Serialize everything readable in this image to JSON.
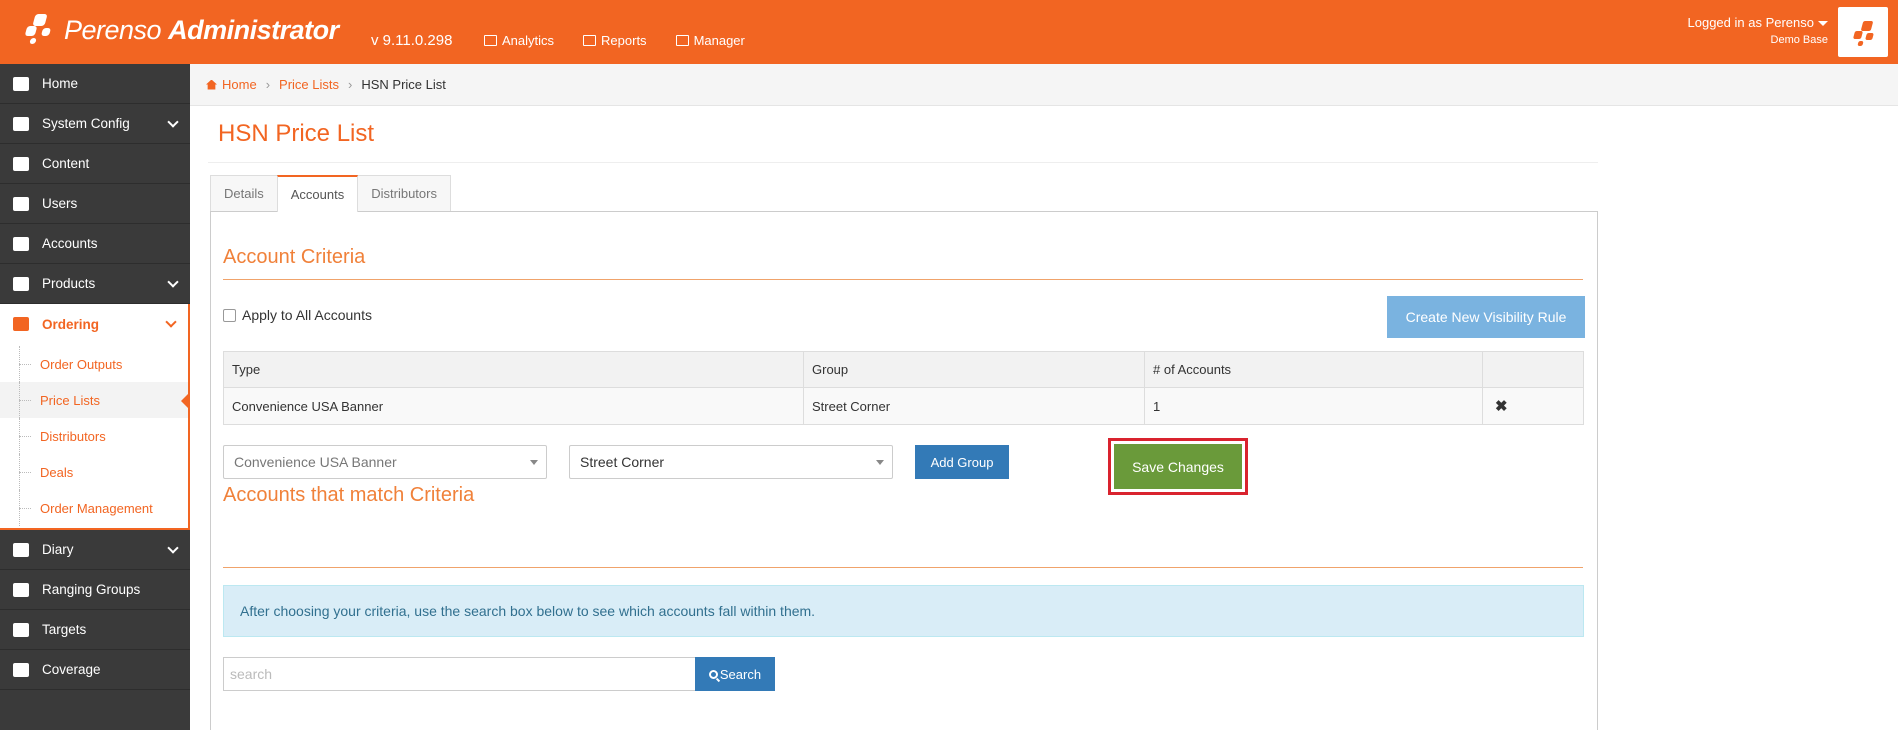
{
  "header": {
    "brand_light": "Perenso",
    "brand_bold": "Administrator",
    "version": "v 9.11.0.298",
    "nav": [
      {
        "label": "Analytics",
        "icon": "chart-icon"
      },
      {
        "label": "Reports",
        "icon": "table-icon"
      },
      {
        "label": "Manager",
        "icon": "briefcase-icon"
      }
    ],
    "user": "Logged in as Perenso",
    "base": "Demo Base",
    "accent_color": "#f26522"
  },
  "sidebar": {
    "items": [
      {
        "label": "Home",
        "icon": "home-icon"
      },
      {
        "label": "System Config",
        "icon": "gear-icon"
      },
      {
        "label": "Content",
        "icon": "file-icon"
      },
      {
        "label": "Users",
        "icon": "user-icon"
      },
      {
        "label": "Accounts",
        "icon": "users-icon"
      },
      {
        "label": "Products",
        "icon": "gift-icon"
      },
      {
        "label": "Ordering",
        "icon": "cart-icon"
      },
      {
        "label": "Diary",
        "icon": "calendar-icon"
      },
      {
        "label": "Ranging Groups",
        "icon": "cubes-icon"
      },
      {
        "label": "Targets",
        "icon": "crosshair-icon"
      },
      {
        "label": "Coverage",
        "icon": "umbrella-icon"
      }
    ],
    "ordering_sub": [
      {
        "label": "Order Outputs"
      },
      {
        "label": "Price Lists"
      },
      {
        "label": "Distributors"
      },
      {
        "label": "Deals"
      },
      {
        "label": "Order Management"
      }
    ]
  },
  "breadcrumb": {
    "home": "Home",
    "parent": "Price Lists",
    "current": "HSN Price List"
  },
  "page": {
    "title": "HSN Price List",
    "tabs": [
      {
        "label": "Details"
      },
      {
        "label": "Accounts"
      },
      {
        "label": "Distributors"
      }
    ]
  },
  "criteria": {
    "section_title": "Account Criteria",
    "apply_all_label": "Apply to All Accounts",
    "create_rule_label": "Create New Visibility Rule",
    "columns": [
      "Type",
      "Group",
      "# of Accounts"
    ],
    "rows": [
      {
        "type": "Convenience USA Banner",
        "group": "Street Corner",
        "count": "1"
      }
    ],
    "type_select": "Convenience USA Banner",
    "group_select": "Street Corner",
    "add_group_label": "Add Group",
    "save_label": "Save Changes"
  },
  "matches": {
    "section_title": "Accounts that match Criteria",
    "info": "After choosing your criteria, use the search box below to see which accounts fall within them.",
    "search_placeholder": "search",
    "search_label": "Search"
  }
}
